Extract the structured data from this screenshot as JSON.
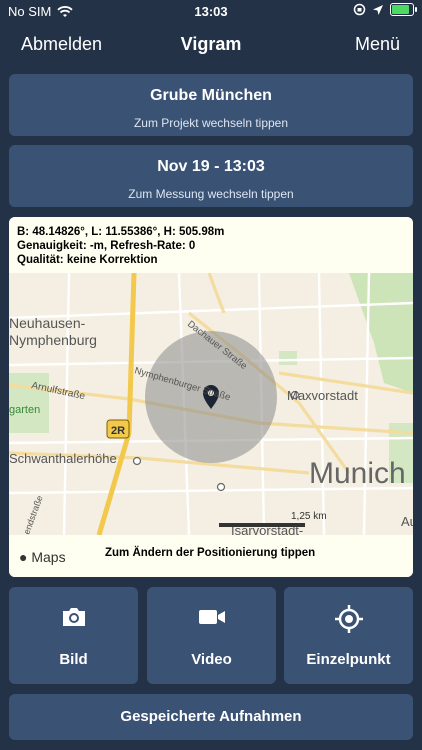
{
  "status": {
    "carrier": "No SIM",
    "time": "13:03"
  },
  "nav": {
    "left": "Abmelden",
    "title": "Vigram",
    "right": "Menü"
  },
  "project": {
    "title": "Grube München",
    "subtitle": "Zum Projekt wechseln tippen"
  },
  "measurement": {
    "title": "Nov 19 - 13:03",
    "subtitle": "Zum Messung wechseln tippen"
  },
  "mapinfo": {
    "line1": "B: 48.14826°, L: 11.55386°, H: 505.98m",
    "line2": "Genauigkeit: -m, Refresh-Rate: 0",
    "line3": "Qualität: keine Korrektion"
  },
  "map": {
    "labels": {
      "neuhausen": "Neuhausen-",
      "nymphenburg": "Nymphenburg",
      "arnulf": "Arnulfstraße",
      "garten": "garten",
      "dachauer": "Dachauer Straße",
      "nymphenburger": "Nymphenburger Straße",
      "maxvorstadt": "Maxvorstadt",
      "schwanthaler": "Schwanthalerhöhe",
      "munich": "Munich",
      "isarvorstadt": "Isarvorstadt-",
      "scale": "1,25 km",
      "badge": "2R",
      "au": "Au",
      "endstrasse": "endstraße"
    },
    "logo": "Maps",
    "footer": "Zum Ändern der Positionierung tippen"
  },
  "actions": {
    "bild": "Bild",
    "video": "Video",
    "einzelpunkt": "Einzelpunkt"
  },
  "saved": "Gespeicherte Aufnahmen"
}
